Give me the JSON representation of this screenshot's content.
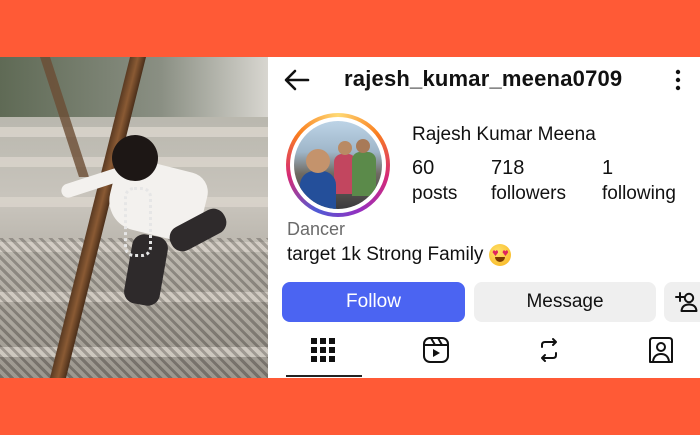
{
  "header": {
    "username": "rajesh_kumar_meena0709"
  },
  "profile": {
    "full_name": "Rajesh Kumar Meena",
    "stats": {
      "posts_count": "60",
      "posts_label": "posts",
      "followers_count": "718",
      "followers_label": "followers",
      "following_count": "1",
      "following_label": "following"
    },
    "category": "Dancer",
    "bio": "target 1k Strong Family"
  },
  "actions": {
    "follow_label": "Follow",
    "message_label": "Message"
  },
  "tabs": [
    "grid-icon",
    "reels-icon",
    "reposts-icon",
    "tagged-icon"
  ],
  "icons": {
    "back": "arrow-left-icon",
    "more": "more-vertical-icon",
    "suggest": "add-person-icon",
    "bio_emoji": "heart-eyes-emoji-icon"
  },
  "colors": {
    "background_band": "#ff5a36",
    "follow_button": "#4b64f2",
    "message_button": "#efefef"
  }
}
